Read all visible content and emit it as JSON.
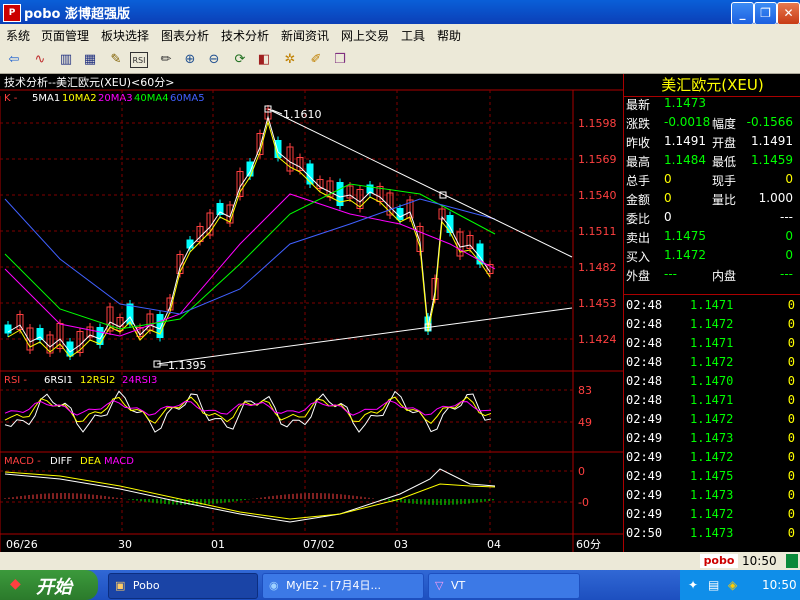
{
  "window": {
    "title": "pobo 澎博超强版",
    "app_icon": "pobo-icon"
  },
  "menu": [
    "系统",
    "页面管理",
    "板块选择",
    "图表分析",
    "技术分析",
    "新闻资讯",
    "网上交易",
    "工具",
    "帮助"
  ],
  "chart_header": {
    "title": "技术分析--美汇欧元(XEU)<60分>",
    "ma_line": {
      "prefix": "K -",
      "items": [
        {
          "text": "5MA1",
          "color": "#ffffff"
        },
        {
          "text": "10MA2",
          "color": "#ffff00"
        },
        {
          "text": "20MA3",
          "color": "#ff00ff"
        },
        {
          "text": "40MA4",
          "color": "#00ff00"
        },
        {
          "text": "60MA5",
          "color": "#4060ff"
        }
      ]
    }
  },
  "price_labels": [
    "1.1598",
    "1.1569",
    "1.1540",
    "1.1511",
    "1.1482",
    "1.1453",
    "1.1424"
  ],
  "annotations": {
    "high": "1.1610",
    "low": "1.1395"
  },
  "rsi_header": {
    "prefix": "RSI -",
    "items": [
      {
        "text": "6RSI1",
        "color": "#ffffff"
      },
      {
        "text": "12RSI2",
        "color": "#ffff00"
      },
      {
        "text": "24RSI3",
        "color": "#ff00ff"
      }
    ]
  },
  "rsi_labels": [
    "83",
    "49"
  ],
  "macd_header": {
    "prefix": "MACD -",
    "items": [
      {
        "text": "DIFF",
        "color": "#ffffff"
      },
      {
        "text": "DEA",
        "color": "#ffff00"
      },
      {
        "text": "MACD",
        "color": "#ff00ff"
      }
    ]
  },
  "macd_labels": [
    "0",
    "-0"
  ],
  "x_labels": [
    "06/26",
    "30",
    "01",
    "07/02",
    "03",
    "04"
  ],
  "period_label": "60分",
  "quote": {
    "name": "美汇欧元(XEU)",
    "rows": [
      {
        "l1": "最新",
        "v1": "1.1473",
        "c1": "green"
      },
      {
        "l1": "涨跌",
        "v1": "-0.0018",
        "c1": "green",
        "l2": "幅度",
        "v2": "-0.1566",
        "c2": "green"
      },
      {
        "l1": "昨收",
        "v1": "1.1491",
        "c1": "white",
        "l2": "开盘",
        "v2": "1.1491",
        "c2": "white"
      },
      {
        "l1": "最高",
        "v1": "1.1484",
        "c1": "green",
        "l2": "最低",
        "v2": "1.1459",
        "c2": "green"
      },
      {
        "l1": "总手",
        "v1": "0",
        "c1": "yellow",
        "l2": "现手",
        "v2": "0",
        "c2": "yellow"
      },
      {
        "l1": "金额",
        "v1": "0",
        "c1": "yellow",
        "l2": "量比",
        "v2": "1.000",
        "c2": "white"
      },
      {
        "l1": "委比",
        "v1": "0",
        "c1": "white",
        "l2": "",
        "v2": "---",
        "c2": "white"
      },
      {
        "l1": "卖出",
        "v1": "1.1475",
        "c1": "green",
        "l2": "",
        "v2": "0",
        "c2": "green"
      },
      {
        "l1": "买入",
        "v1": "1.1472",
        "c1": "green",
        "l2": "",
        "v2": "0",
        "c2": "green"
      },
      {
        "l1": "外盘",
        "v1": "---",
        "c1": "green",
        "l2": "内盘",
        "v2": "---",
        "c2": "green"
      }
    ],
    "ticks": [
      {
        "time": "02:48",
        "price": "1.1471",
        "vol": "0"
      },
      {
        "time": "02:48",
        "price": "1.1472",
        "vol": "0"
      },
      {
        "time": "02:48",
        "price": "1.1471",
        "vol": "0"
      },
      {
        "time": "02:48",
        "price": "1.1472",
        "vol": "0"
      },
      {
        "time": "02:48",
        "price": "1.1470",
        "vol": "0"
      },
      {
        "time": "02:48",
        "price": "1.1471",
        "vol": "0"
      },
      {
        "time": "02:49",
        "price": "1.1472",
        "vol": "0"
      },
      {
        "time": "02:49",
        "price": "1.1473",
        "vol": "0"
      },
      {
        "time": "02:49",
        "price": "1.1472",
        "vol": "0"
      },
      {
        "time": "02:49",
        "price": "1.1475",
        "vol": "0"
      },
      {
        "time": "02:49",
        "price": "1.1473",
        "vol": "0"
      },
      {
        "time": "02:49",
        "price": "1.1472",
        "vol": "0"
      },
      {
        "time": "02:50",
        "price": "1.1473",
        "vol": "0"
      }
    ]
  },
  "statusbar": {
    "brand": "pobo",
    "time": "10:50"
  },
  "taskbar": {
    "start": "开始",
    "tasks": [
      "Pobo",
      "MyIE2 - [7月4日...",
      "VT"
    ],
    "clock": "10:50"
  }
}
